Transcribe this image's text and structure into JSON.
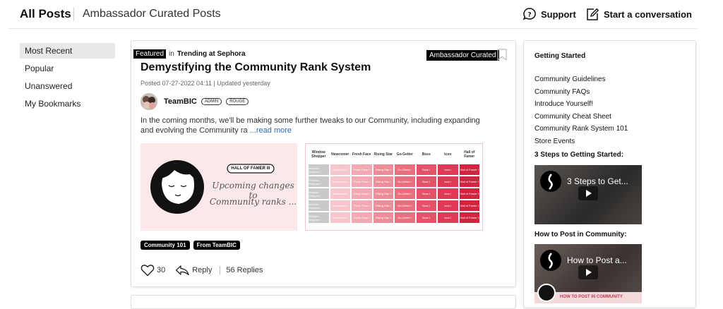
{
  "header": {
    "title": "All Posts",
    "subtitle": "Ambassador Curated Posts",
    "support_label": "Support",
    "conversation_label": "Start a conversation"
  },
  "sidenav": {
    "items": [
      "Most Recent",
      "Popular",
      "Unanswered",
      "My Bookmarks"
    ],
    "active": "Most Recent"
  },
  "post": {
    "featured_badge": "Featured",
    "in_text": "in",
    "category": "Trending at Sephora",
    "curated_badge": "Ambassador Curated",
    "title": "Demystifying the Community Rank System",
    "meta": "Posted 07-27-2022 04:11  | Updated yesterday",
    "author": "TeamBIC",
    "ranks": [
      "ADMIN",
      "ROUGE"
    ],
    "body": "In the coming months, we'll be making some further tweaks to our Community, including expanding and evolving the Community ra",
    "read_more": "...read more",
    "image1": {
      "badge": "HALL OF FAMER III",
      "caption_line1": "Upcoming changes to",
      "caption_line2": "Community ranks ..."
    },
    "image2": {
      "columns": [
        "Window Shopper",
        "Newcomer",
        "Fresh Face",
        "Rising Star",
        "Go-Getter",
        "Boss",
        "Icon",
        "Hall of Famer"
      ],
      "row_labels": [
        "Window Shopper I",
        "Newcomer I",
        "Fresh Face I",
        "Rising Star I",
        "Go-Getter I",
        "Boss I",
        "Icon I",
        "Hall of Famer I"
      ]
    },
    "tags": [
      "Community 101",
      "From TeamBIC"
    ],
    "likes": "30",
    "reply_label": "Reply",
    "replies": "56 Replies"
  },
  "sidebar": {
    "heading": "Getting Started",
    "links": [
      "Community Guidelines",
      "Community FAQs",
      "Introduce Yourself!",
      "Community Cheat Sheet",
      "Community Rank System 101",
      "Store Events"
    ],
    "section1": "3 Steps to Getting Started:",
    "video1_title": "3 Steps to Get...",
    "section2": "How to Post in Community:",
    "video2_title": "How to Post a...",
    "video2_caption": "HOW TO POST IN COMMUNITY"
  },
  "colors": {
    "pink_light": "#fbe9ea",
    "pink_mid": "#f28c98",
    "red": "#e23b55",
    "black": "#000000"
  }
}
